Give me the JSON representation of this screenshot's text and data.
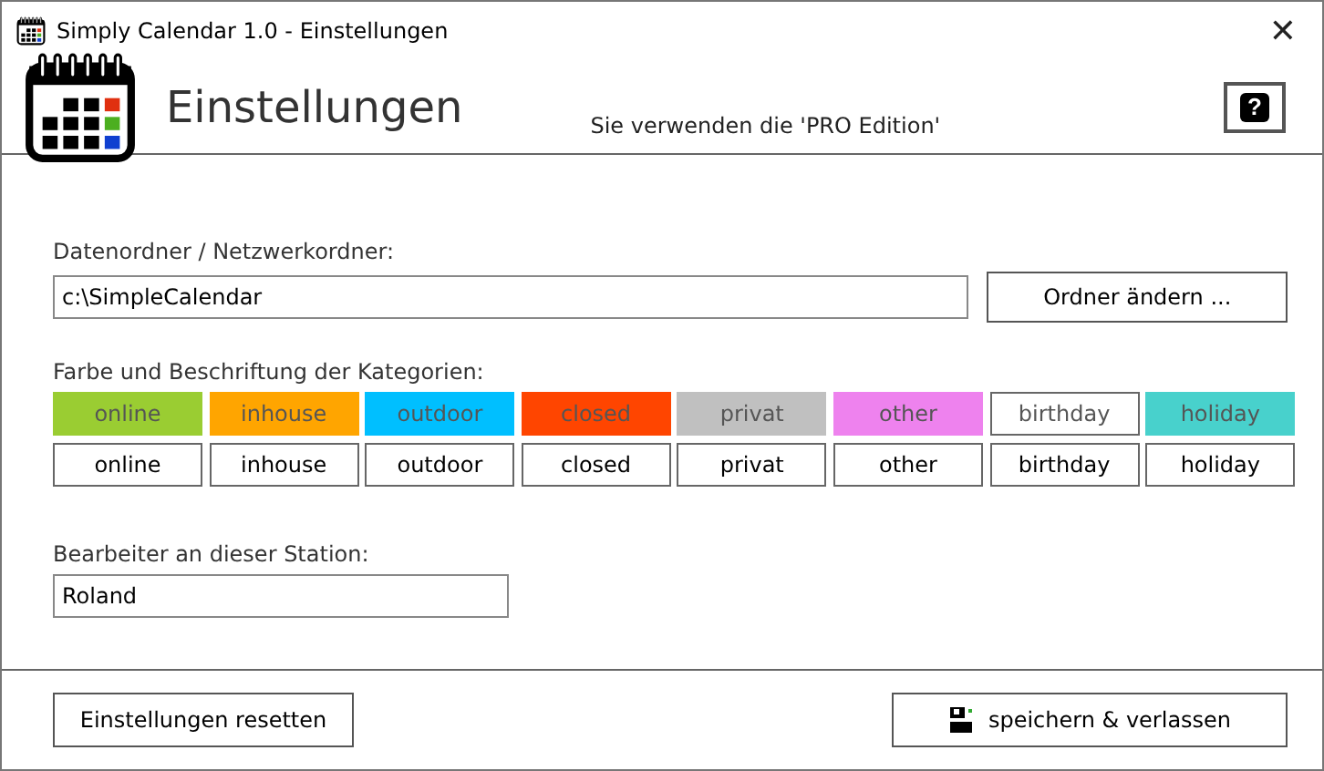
{
  "window": {
    "title": "Simply Calendar 1.0 - Einstellungen",
    "close": "✕"
  },
  "header": {
    "title": "Einstellungen",
    "edition": "Sie verwenden die 'PRO Edition'",
    "help_button": "?"
  },
  "data_folder": {
    "label": "Datenordner / Netzwerkordner:",
    "value": "c:\\SimpleCalendar",
    "button": "Ordner ändern ..."
  },
  "categories": {
    "label": "Farbe und Beschriftung der Kategorien:",
    "items": [
      {
        "name": "online",
        "label": "online",
        "color": "#9acd32"
      },
      {
        "name": "inhouse",
        "label": "inhouse",
        "color": "#ffa500"
      },
      {
        "name": "outdoor",
        "label": "outdoor",
        "color": "#00bfff"
      },
      {
        "name": "closed",
        "label": "closed",
        "color": "#ff4500"
      },
      {
        "name": "privat",
        "label": "privat",
        "color": "#c0c0c0"
      },
      {
        "name": "other",
        "label": "other",
        "color": "#ee82ee"
      },
      {
        "name": "birthday",
        "label": "birthday",
        "color": "#ffffff"
      },
      {
        "name": "holiday",
        "label": "holiday",
        "color": "#48d1cc"
      }
    ]
  },
  "editor": {
    "label": "Bearbeiter an dieser Station:",
    "value": "Roland"
  },
  "footer": {
    "reset_button": "Einstellungen resetten",
    "save_button": "speichern & verlassen"
  }
}
